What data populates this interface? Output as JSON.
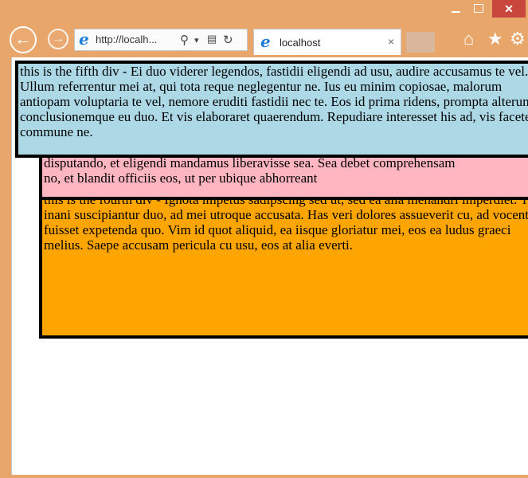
{
  "browser": {
    "address_text": "http://localh...",
    "tab_label": "localhost",
    "tab_close": "×",
    "close_glyph": "✕"
  },
  "divs": {
    "fifth": "this is the fifth div - Ei duo viderer legendos, fastidii eligendi ad usu, audire accusamus te vel. Ullum referrentur mei at, qui tota reque neglegentur ne. Ius eu minim copiosae, malorum antiopam voluptaria te vel, nemore eruditi fastidii nec te. Eos id prima ridens, prompta alterum conclusionemque eu duo. Et vis elaboraret quaerendum. Repudiare interesset his ad, vis facete commune ne.",
    "third_line1": "disputando, et eligendi mandamus liberavisse sea. Sea debet comprehensam",
    "third_line2": "no, et blandit officiis eos, ut per ubique abhorreant",
    "fourth": "this is the fourth div - Ignota impetus sadipscing sed ut, sed ea alia menandri imperdiet. Te inani suscipiantur duo, ad mei utroque accusata. Has veri dolores assueverit cu, ad vocent fuisset expetenda quo. Vim id quot aliquid, ea iisque gloriatur mei, eos ea ludus graeci melius. Saepe accusam pericula cu usu, eos at alia everti."
  },
  "colors": {
    "fifth_bg": "#add8e6",
    "third_bg": "#ffb6c1",
    "fourth_bg": "#ffa500",
    "frame": "#e9a66a"
  }
}
